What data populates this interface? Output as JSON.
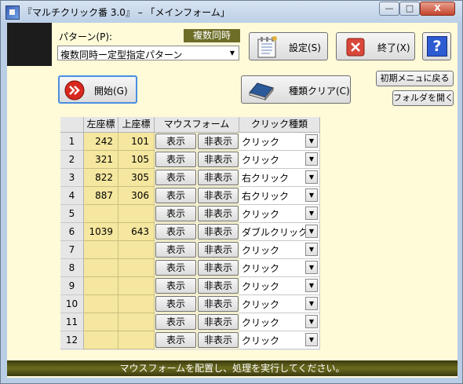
{
  "window": {
    "title": "『マルチクリック番 3.0』 – 「メインフォーム」",
    "app_icon": "app-icon",
    "caption_buttons": {
      "minimize": "—",
      "maximize": "□",
      "close": "X"
    }
  },
  "pattern": {
    "label": "パターン(P):",
    "badge": "複数同時",
    "selected": "複数同時ー定型指定パターン"
  },
  "toolbar": {
    "settings_label": "設定(S)",
    "exit_label": "終了(X)",
    "help_glyph": "?",
    "start_label": "開始(G)",
    "clear_label": "種類クリア(C)",
    "reset_menu_label": "初期メニュに戻る",
    "open_folder_label": "フォルダを開く"
  },
  "colors": {
    "client_bg": "#fffbd9",
    "coord_cell": "#f5e79f",
    "status_bar": "#5a5a1a",
    "badge": "#6d6d27"
  },
  "table": {
    "headers": {
      "left": "左座標",
      "top": "上座標",
      "mouse_form": "マウスフォーム",
      "click_type": "クリック種類"
    },
    "show_label": "表示",
    "hide_label": "非表示",
    "rows": [
      {
        "num": "1",
        "left": "242",
        "top": "101",
        "click": "クリック"
      },
      {
        "num": "2",
        "left": "321",
        "top": "105",
        "click": "クリック"
      },
      {
        "num": "3",
        "left": "822",
        "top": "305",
        "click": "右クリック"
      },
      {
        "num": "4",
        "left": "887",
        "top": "306",
        "click": "右クリック"
      },
      {
        "num": "5",
        "left": "",
        "top": "",
        "click": "クリック"
      },
      {
        "num": "6",
        "left": "1039",
        "top": "643",
        "click": "ダブルクリック"
      },
      {
        "num": "7",
        "left": "",
        "top": "",
        "click": "クリック"
      },
      {
        "num": "8",
        "left": "",
        "top": "",
        "click": "クリック"
      },
      {
        "num": "9",
        "left": "",
        "top": "",
        "click": "クリック"
      },
      {
        "num": "10",
        "left": "",
        "top": "",
        "click": "クリック"
      },
      {
        "num": "11",
        "left": "",
        "top": "",
        "click": "クリック"
      },
      {
        "num": "12",
        "left": "",
        "top": "",
        "click": "クリック"
      }
    ]
  },
  "status": {
    "message": "マウスフォームを配置し、処理を実行してください。"
  }
}
